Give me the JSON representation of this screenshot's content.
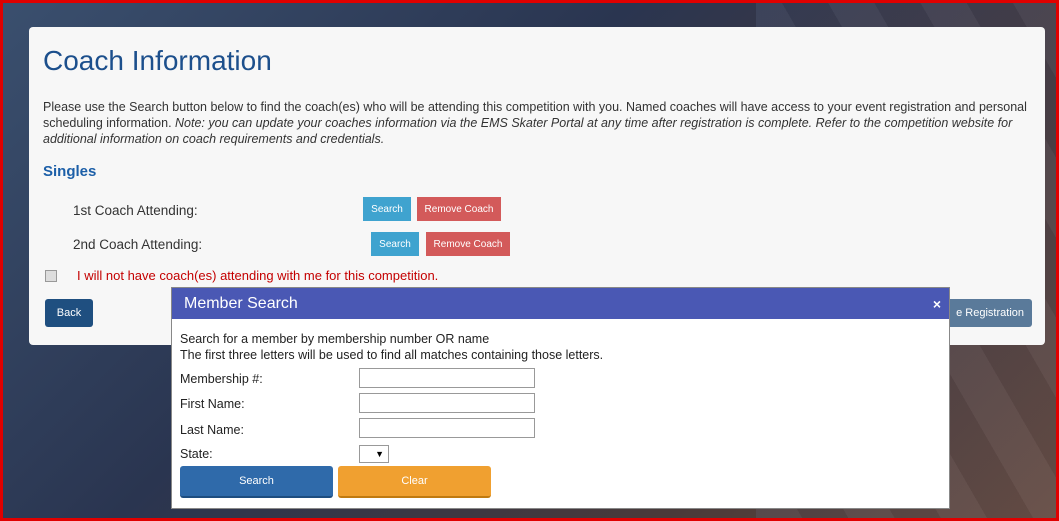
{
  "page": {
    "title": "Coach Information",
    "intro_part1": "Please use the Search button below to find the coach(es) who will be attending this competition with you. Named coaches will have access to your event registration and personal scheduling information. ",
    "intro_note": "Note: you can update your coaches information via the EMS Skater Portal at any time after registration is complete. Refer to the competition website for additional information on coach requirements and credentials.",
    "section": "Singles",
    "coach1_label": "1st Coach Attending:",
    "coach2_label": "2nd Coach Attending:",
    "search_label": "Search",
    "remove_label": "Remove Coach",
    "no_coach_label": "I will not have coach(es) attending with me for this competition.",
    "back_label": "Back",
    "registration_label": "e Registration"
  },
  "modal": {
    "title": "Member Search",
    "close": "×",
    "line1": "Search for a member by membership number OR name",
    "line2": "The first three letters will be used to find all matches containing those letters.",
    "membership_label": "Membership #:",
    "first_label": "First Name:",
    "last_label": "Last Name:",
    "state_label": "State:",
    "state_value": "▼",
    "search_label": "Search",
    "clear_label": "Clear"
  },
  "colors": {
    "title": "#1c4f8c",
    "modal_header": "#4a58b4",
    "search_button": "#2f6aaa",
    "clear_button": "#f0a030",
    "remove_button": "#d35a5a",
    "warning_text": "#c40000"
  }
}
